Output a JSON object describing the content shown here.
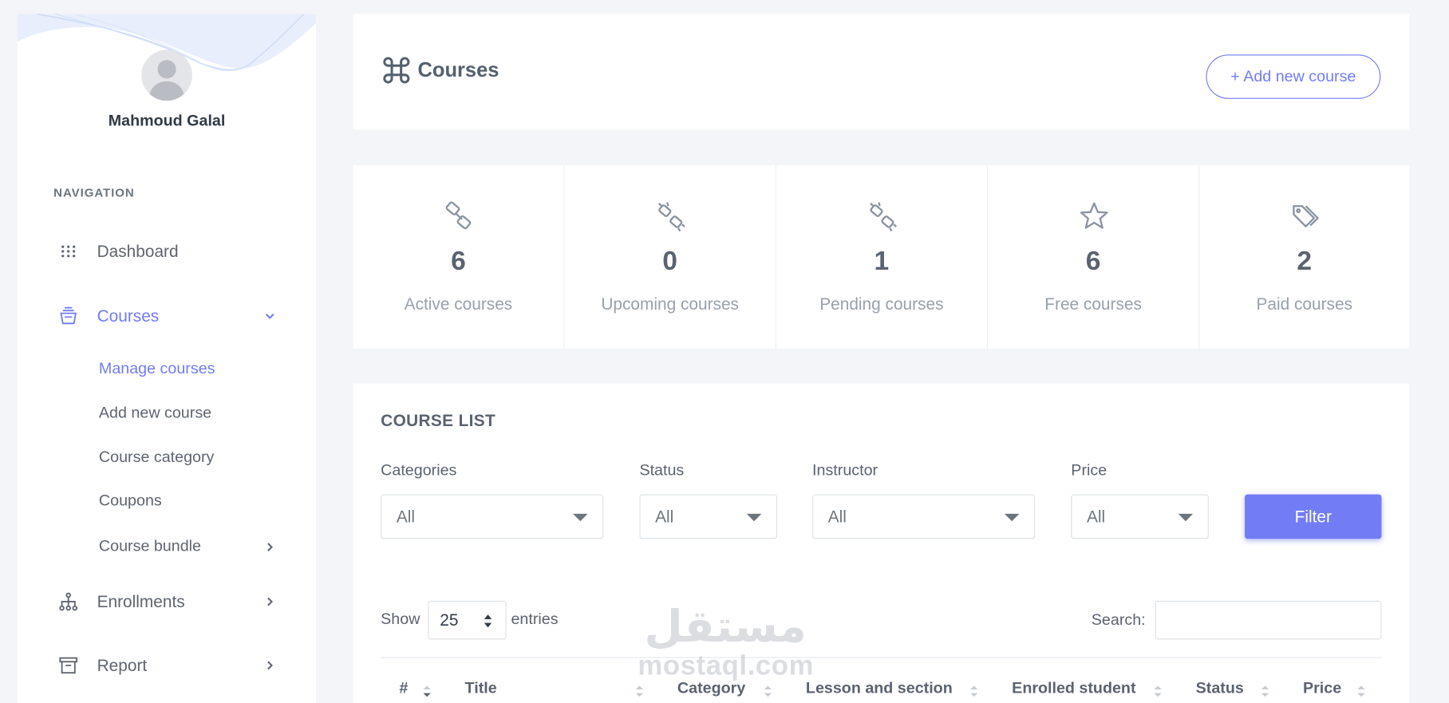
{
  "user": {
    "name": "Mahmoud Galal"
  },
  "sidebar": {
    "nav_title": "NAVIGATION",
    "items": [
      {
        "label": "Dashboard",
        "icon": "grid-dots-icon"
      },
      {
        "label": "Courses",
        "icon": "courses-icon",
        "active": true,
        "expanded": true
      },
      {
        "label": "Enrollments",
        "icon": "sitemap-icon"
      },
      {
        "label": "Report",
        "icon": "archive-icon"
      }
    ],
    "courses_sub": [
      {
        "label": "Manage courses",
        "active": true
      },
      {
        "label": "Add new course"
      },
      {
        "label": "Course category"
      },
      {
        "label": "Coupons"
      },
      {
        "label": "Course bundle"
      }
    ]
  },
  "header": {
    "title": "Courses",
    "add_button": "+ Add new course"
  },
  "stats": [
    {
      "value": "6",
      "label": "Active courses",
      "icon": "link-icon"
    },
    {
      "value": "0",
      "label": "Upcoming courses",
      "icon": "broken-link-icon"
    },
    {
      "value": "1",
      "label": "Pending courses",
      "icon": "broken-link-icon"
    },
    {
      "value": "6",
      "label": "Free courses",
      "icon": "star-icon"
    },
    {
      "value": "2",
      "label": "Paid courses",
      "icon": "tags-icon"
    }
  ],
  "course_list": {
    "title": "COURSE LIST",
    "filters": {
      "categories": {
        "label": "Categories",
        "value": "All"
      },
      "status": {
        "label": "Status",
        "value": "All"
      },
      "instructor": {
        "label": "Instructor",
        "value": "All"
      },
      "price": {
        "label": "Price",
        "value": "All"
      },
      "button": "Filter"
    },
    "show_label": "Show",
    "entries_value": "25",
    "entries_label": "entries",
    "search_label": "Search:",
    "columns": [
      "#",
      "Title",
      "Category",
      "Lesson and section",
      "Enrolled student",
      "Status",
      "Price"
    ]
  },
  "watermark": {
    "arabic": "مستقل",
    "latin": "mostaql.com"
  },
  "colors": {
    "accent": "#727cf5",
    "sidebar_bg": "#ffffff",
    "page_bg": "#f4f5f9"
  }
}
